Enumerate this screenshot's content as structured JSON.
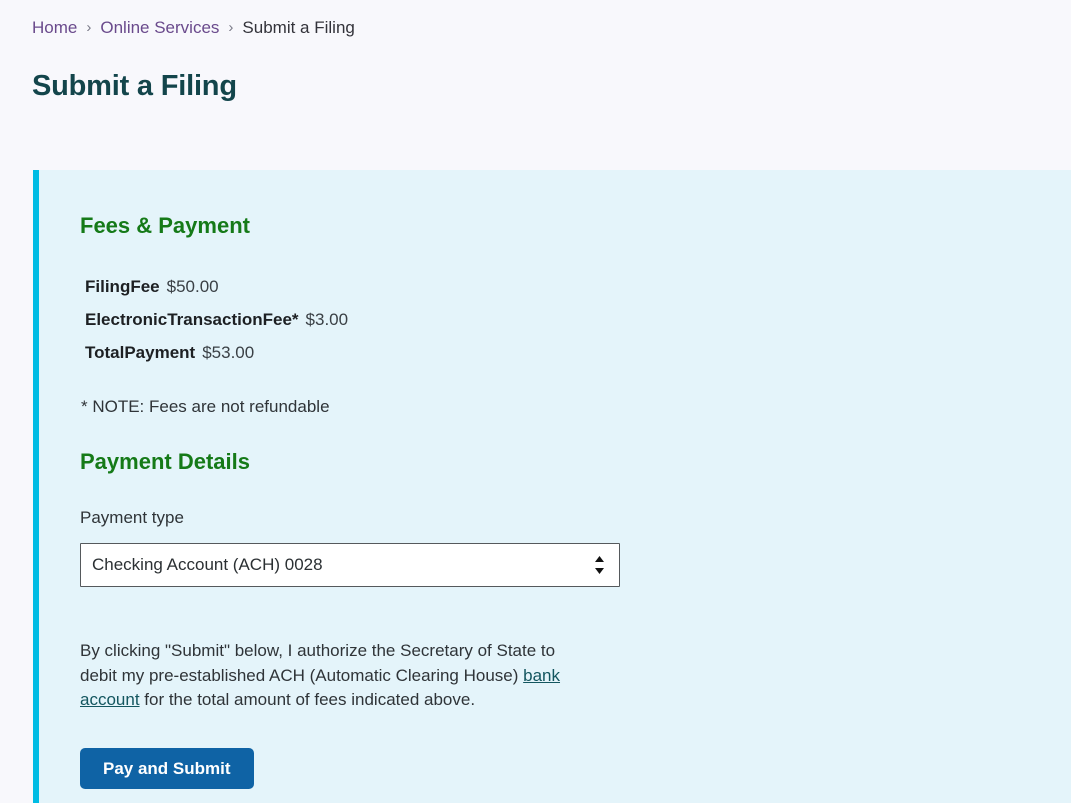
{
  "breadcrumb": {
    "items": [
      {
        "label": "Home",
        "current": false
      },
      {
        "label": "Online Services",
        "current": false
      },
      {
        "label": "Submit a Filing",
        "current": true
      }
    ],
    "separator": "›"
  },
  "page": {
    "title": "Submit a Filing"
  },
  "panel": {
    "accent_color": "#00bce4",
    "background_color": "#e4f4fa"
  },
  "fees_section": {
    "heading": "Fees & Payment",
    "rows": [
      {
        "label": "FilingFee",
        "value": "$50.00"
      },
      {
        "label": "ElectronicTransactionFee*",
        "value": "$3.00"
      },
      {
        "label": "TotalPayment",
        "value": "$53.00"
      }
    ],
    "note": "* NOTE: Fees are not refundable"
  },
  "payment_section": {
    "heading": "Payment Details",
    "payment_type_label": "Payment type",
    "payment_type_value": "Checking Account (ACH) 0028",
    "payment_type_options": [
      "Checking Account (ACH) 0028"
    ]
  },
  "authorization": {
    "text_before": "By clicking \"Submit\" below, I authorize the Secretary of State to debit my pre-established ACH (Automatic Clearing House) ",
    "link_text": "bank account",
    "text_after": " for the total amount of fees indicated above."
  },
  "actions": {
    "submit_label": "Pay and Submit",
    "submit_color": "#0f63a5"
  }
}
